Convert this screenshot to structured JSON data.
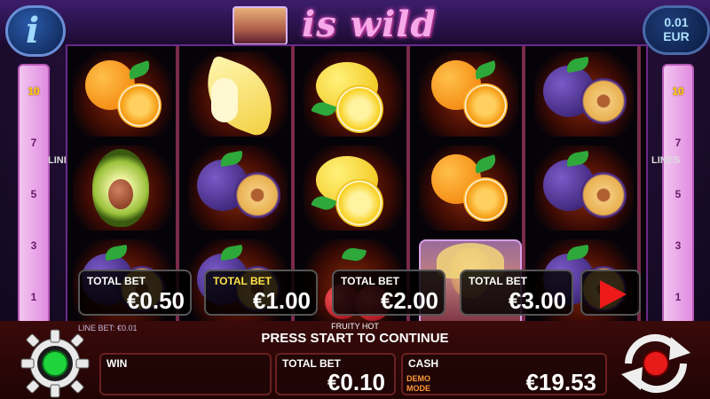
{
  "header": {
    "title": "is wild"
  },
  "info_button": {
    "glyph": "i"
  },
  "coin": {
    "value": "0.01",
    "currency": "EUR"
  },
  "lines": {
    "label": "LINES",
    "numbers": [
      "10",
      "7",
      "5",
      "3",
      "1"
    ]
  },
  "bet_options": [
    {
      "label": "TOTAL BET",
      "value": "€0.50",
      "selected": false
    },
    {
      "label": "TOTAL BET",
      "value": "€1.00",
      "selected": true
    },
    {
      "label": "TOTAL BET",
      "value": "€2.00",
      "selected": false
    },
    {
      "label": "TOTAL BET",
      "value": "€3.00",
      "selected": false
    }
  ],
  "bottom": {
    "line_bet": "LINE BET: €0.01",
    "game_name": "FRUITY HOT",
    "message": "PRESS START TO CONTINUE",
    "win_label": "WIN",
    "win_value": "",
    "total_bet_label": "TOTAL BET",
    "total_bet_value": "€0.10",
    "cash_label": "CASH",
    "cash_value": "€19.53",
    "demo_mode": "DEMO MODE"
  },
  "reels": [
    [
      "orange",
      "avocado",
      "plum"
    ],
    [
      "banana",
      "plum",
      "plum"
    ],
    [
      "lemon",
      "lemon",
      "cherry"
    ],
    [
      "orange",
      "orange",
      "wild"
    ],
    [
      "plum",
      "plum",
      "plum"
    ]
  ],
  "colors": {
    "accent_pink": "#f7a8e8",
    "play_red": "#ee1a1a",
    "selected_gold": "#ffe24a",
    "start_green": "#1fd43a"
  }
}
